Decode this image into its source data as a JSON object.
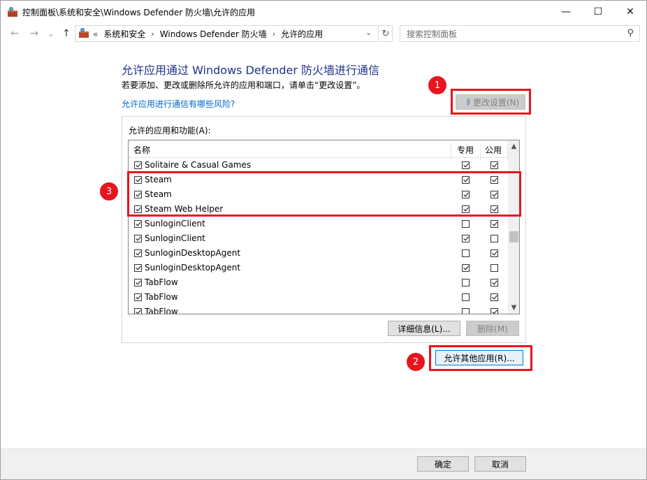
{
  "window": {
    "title": "控制面板\\系统和安全\\Windows Defender 防火墙\\允许的应用",
    "minimize_glyph": "—",
    "maximize_glyph": "☐",
    "close_glyph": "✕"
  },
  "nav": {
    "back_glyph": "←",
    "forward_glyph": "→",
    "recent_glyph": "⌄",
    "up_glyph": "↑",
    "overflow": "«",
    "breadcrumbs": [
      "系统和安全",
      "Windows Defender 防火墙",
      "允许的应用"
    ],
    "crumb_sep": "›",
    "dropdown_glyph": "⌄",
    "refresh_glyph": "↻",
    "search_placeholder": "搜索控制面板",
    "search_glyph": "⚲"
  },
  "content": {
    "heading": "允许应用通过 Windows Defender 防火墙进行通信",
    "description": "若要添加、更改或删除所允许的应用和端口，请单击“更改设置”。",
    "risk_link": "允许应用进行通信有哪些风险?",
    "change_settings": "更改设置(N)",
    "group_label": "允许的应用和功能(A):",
    "columns": {
      "name": "名称",
      "private": "专用",
      "public": "公用"
    },
    "apps": [
      {
        "name": "Solitaire & Casual Games",
        "enabled": true,
        "private": true,
        "public": true
      },
      {
        "name": "Steam",
        "enabled": true,
        "private": true,
        "public": true
      },
      {
        "name": "Steam",
        "enabled": true,
        "private": true,
        "public": true
      },
      {
        "name": "Steam Web Helper",
        "enabled": true,
        "private": true,
        "public": true
      },
      {
        "name": "SunloginClient",
        "enabled": true,
        "private": false,
        "public": true
      },
      {
        "name": "SunloginClient",
        "enabled": true,
        "private": true,
        "public": false
      },
      {
        "name": "SunloginDesktopAgent",
        "enabled": true,
        "private": false,
        "public": true
      },
      {
        "name": "SunloginDesktopAgent",
        "enabled": true,
        "private": true,
        "public": false
      },
      {
        "name": "TabFlow",
        "enabled": true,
        "private": false,
        "public": true
      },
      {
        "name": "TabFlow",
        "enabled": true,
        "private": false,
        "public": true
      },
      {
        "name": "TabFlow",
        "enabled": true,
        "private": false,
        "public": true
      }
    ],
    "scroll_up_glyph": "▲",
    "scroll_down_glyph": "▼",
    "details": "详细信息(L)...",
    "remove": "删除(M)",
    "allow_other": "允许其他应用(R)..."
  },
  "annotations": {
    "badge1": "1",
    "badge2": "2",
    "badge3": "3"
  },
  "footer": {
    "ok": "确定",
    "cancel": "取消"
  },
  "colors": {
    "accent_red": "#e8141e",
    "heading_blue": "#1e3287",
    "link_blue": "#0066cc"
  }
}
